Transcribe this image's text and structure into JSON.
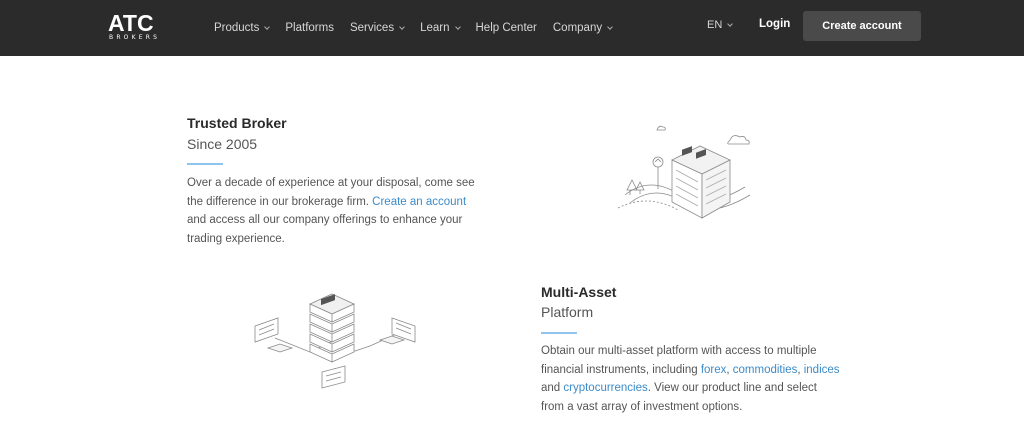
{
  "header": {
    "logo_main": "ATC",
    "logo_sub": "BROKERS",
    "nav": [
      {
        "label": "Products",
        "dropdown": true
      },
      {
        "label": "Platforms",
        "dropdown": false
      },
      {
        "label": "Services",
        "dropdown": true
      },
      {
        "label": "Learn",
        "dropdown": true
      },
      {
        "label": "Help Center",
        "dropdown": false
      },
      {
        "label": "Company",
        "dropdown": true
      }
    ],
    "language": "EN",
    "login": "Login",
    "create_account": "Create account"
  },
  "features": [
    {
      "title": "Trusted Broker",
      "subtitle": "Since 2005",
      "body_1": "Over a decade of experience at your disposal, come see the difference in our brokerage firm. ",
      "link_1": "Create an account",
      "body_2": " and access all our company offerings to enhance your trading experience."
    },
    {
      "title": "Multi-Asset",
      "subtitle": "Platform",
      "body_1": "Obtain our multi-asset platform with access to multiple financial instruments, including ",
      "link_forex": "forex",
      "sep_1": ", ",
      "link_commodities": "commodities",
      "sep_2": ", ",
      "link_indices": "indices",
      "sep_3": " and ",
      "link_crypto": "cryptocurrencies",
      "body_2": ". View our product line and select from a vast array of investment options."
    }
  ],
  "colors": {
    "navbar": "#2b2b2b",
    "button": "#4a4a4a",
    "link": "#3b8bc9",
    "accent": "#8ec5ec"
  }
}
